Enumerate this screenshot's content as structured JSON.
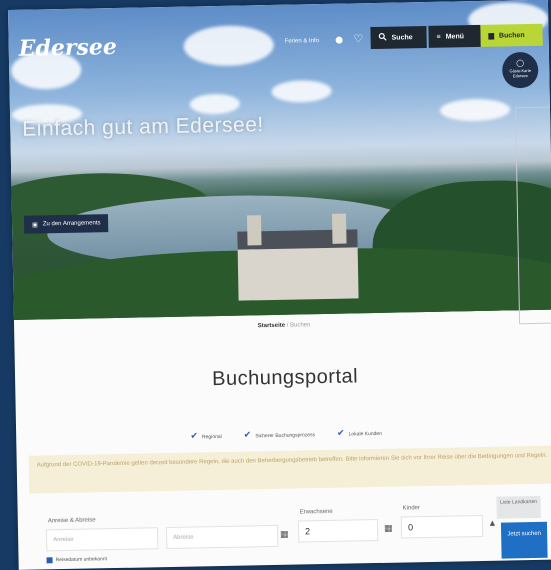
{
  "header": {
    "logo": "Edersee",
    "nav_text": "Ferien & Info",
    "search_label": "Suche",
    "menu_label": "Menü",
    "booking_label": "Buchen",
    "badge_text": "Gäste-Karte Edersee"
  },
  "hero": {
    "title": "Einfach gut am Edersee!",
    "arrangement_button": "Zu den Arrangements"
  },
  "breadcrumb": {
    "home": "Startseite",
    "current": "Buchen"
  },
  "main": {
    "title": "Buchungsportal",
    "checks": [
      "Regional",
      "Sicherer Buchungsprozess",
      "Lokale Kunden"
    ],
    "notice": "Aufgrund der COVID-19-Pandemie gelten derzeit besondere Regeln, die auch den Beherbergungsbetrieb betreffen. Bitte informieren Sie sich vor Ihrer Reise über die Bedingungen und Regeln."
  },
  "form": {
    "travel_date_label": "Anreise & Abreise",
    "arrival_placeholder": "Anreise",
    "departure_placeholder": "Abreise",
    "adults_label": "Erwachsene",
    "adults_value": "2",
    "children_label": "Kinder",
    "children_value": "0",
    "map_button": "Liste Landkarten",
    "search_button": "Jetzt suchen",
    "checkbox_label": "Reisedatum unbekannt"
  },
  "colors": {
    "page_bg": "#163a63",
    "accent_green": "#b9d636",
    "accent_blue": "#1f6fc5",
    "dark": "#1f2730"
  }
}
